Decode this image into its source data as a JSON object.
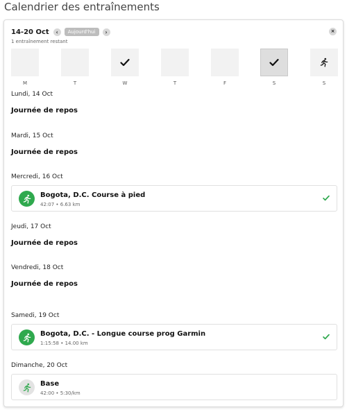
{
  "page_title": "Calendrier des entraînements",
  "header": {
    "week_range": "14-20 Oct",
    "prev_label": "‹",
    "today_label": "Aujourd'hui",
    "next_label": "›",
    "close_label": "×",
    "remaining_text": "1 entraînement restant"
  },
  "week_days": [
    {
      "letter": "M",
      "status": "empty"
    },
    {
      "letter": "T",
      "status": "empty"
    },
    {
      "letter": "W",
      "status": "done"
    },
    {
      "letter": "T",
      "status": "empty"
    },
    {
      "letter": "F",
      "status": "empty"
    },
    {
      "letter": "S",
      "status": "done-selected"
    },
    {
      "letter": "S",
      "status": "planned-run"
    }
  ],
  "days": [
    {
      "date": "Lundi, 14 Oct",
      "rest": "Journée de repos"
    },
    {
      "date": "Mardi, 15 Oct",
      "rest": "Journée de repos"
    },
    {
      "date": "Mercredi, 16 Oct",
      "activity": {
        "title": "Bogota, D.C. Course à pied",
        "meta": "42:07 • 6.63 km",
        "completed": true,
        "icon": "runner-icon"
      }
    },
    {
      "date": "Jeudi, 17 Oct",
      "rest": "Journée de repos"
    },
    {
      "date": "Vendredi, 18 Oct",
      "rest": "Journée de repos"
    },
    {
      "date": "Samedi, 19 Oct",
      "activity": {
        "title": "Bogota, D.C. - Longue course prog Garmin",
        "meta": "1:15:58 • 14.00 km",
        "completed": true,
        "icon": "runner-icon"
      }
    },
    {
      "date": "Dimanche, 20 Oct",
      "activity": {
        "title": "Base",
        "meta": "42:00 • 5:30/km",
        "completed": false,
        "icon": "runner-icon"
      }
    }
  ],
  "colors": {
    "accent_green": "#2fa94e",
    "tile_bg": "#f2f2f2",
    "check_green": "#2fa94e"
  }
}
